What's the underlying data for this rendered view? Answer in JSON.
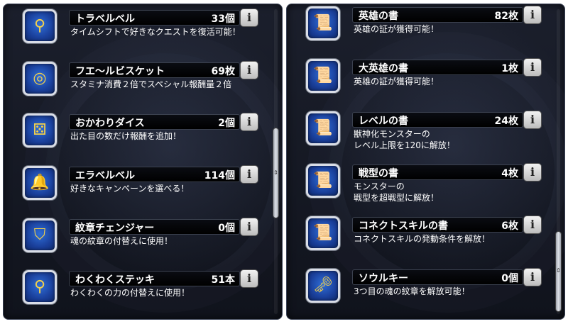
{
  "left_items": [
    {
      "icon": "bell-staff-icon",
      "glyph": "⚲",
      "name": "トラベルベル",
      "count": "33個",
      "desc": [
        "タイムシフトで好きなクエストを復活可能！"
      ]
    },
    {
      "icon": "biscuit-icon",
      "glyph": "◎",
      "name": "フエ～ルビスケット",
      "count": "69枚",
      "desc": [
        "スタミナ消費２倍でスペシャル報酬量２倍"
      ]
    },
    {
      "icon": "dice-icon",
      "glyph": "⚄",
      "name": "おかわりダイス",
      "count": "2個",
      "desc": [
        "出た目の数だけ報酬を追加！"
      ]
    },
    {
      "icon": "bell-icon",
      "glyph": "🔔",
      "name": "エラベルベル",
      "count": "114個",
      "desc": [
        "好きなキャンペーンを選べる！"
      ]
    },
    {
      "icon": "crest-changer-icon",
      "glyph": "⛉",
      "name": "紋章チェンジャー",
      "count": "0個",
      "desc": [
        "魂の紋章の付替えに使用！"
      ]
    },
    {
      "icon": "wand-icon",
      "glyph": "⚲",
      "name": "わくわくステッキ",
      "count": "51本",
      "desc": [
        "わくわくの力の付替えに使用！"
      ]
    }
  ],
  "right_items": [
    {
      "icon": "scroll-hero-icon",
      "glyph": "📜",
      "name": "英雄の書",
      "count": "82枚",
      "desc": [
        "英雄の証が獲得可能！"
      ]
    },
    {
      "icon": "scroll-great-hero-icon",
      "glyph": "📜",
      "name": "大英雄の書",
      "count": "1枚",
      "desc": [
        "英雄の証が獲得可能！"
      ]
    },
    {
      "icon": "scroll-level-icon",
      "glyph": "📜",
      "name": "レベルの書",
      "count": "24枚",
      "desc": [
        "獣神化モンスターの",
        "レベル上限を120に解放！"
      ]
    },
    {
      "icon": "scroll-form-icon",
      "glyph": "📜",
      "name": "戦型の書",
      "count": "4枚",
      "desc": [
        "モンスターの",
        "戦型を超戦型に解放！"
      ]
    },
    {
      "icon": "scroll-connect-icon",
      "glyph": "📜",
      "name": "コネクトスキルの書",
      "count": "6枚",
      "desc": [
        "コネクトスキルの発動条件を解放！"
      ]
    },
    {
      "icon": "soul-key-icon",
      "glyph": "🗝",
      "name": "ソウルキー",
      "count": "0個",
      "desc": [
        "3つ目の魂の紋章を解放可能！"
      ]
    }
  ],
  "info_label": "i"
}
